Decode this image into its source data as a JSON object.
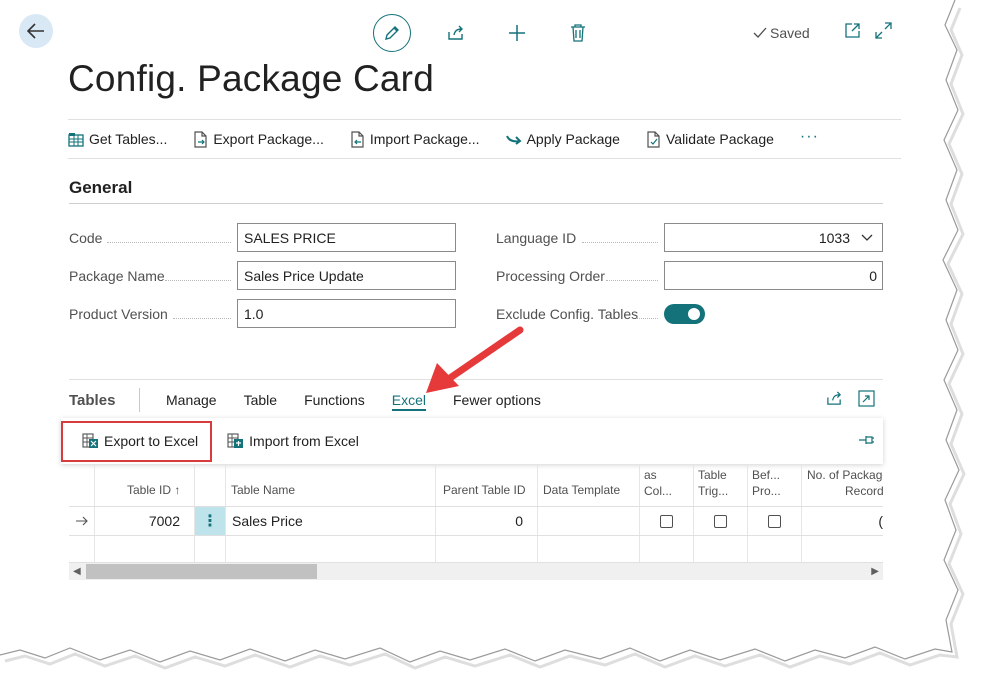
{
  "header": {
    "title": "Config. Package Card",
    "saved_label": "Saved",
    "icons": [
      "back-arrow-icon",
      "edit-pencil-icon",
      "share-icon",
      "plus-icon",
      "trash-icon",
      "checkmark-icon",
      "open-new-window-icon",
      "expand-icon"
    ]
  },
  "actions": [
    {
      "label": "Get Tables...",
      "icon": "get-tables-icon"
    },
    {
      "label": "Export Package...",
      "icon": "export-doc-icon"
    },
    {
      "label": "Import Package...",
      "icon": "import-doc-icon"
    },
    {
      "label": "Apply Package",
      "icon": "apply-arrow-icon"
    },
    {
      "label": "Validate Package",
      "icon": "validate-doc-icon"
    }
  ],
  "general": {
    "title": "General",
    "code": {
      "label": "Code",
      "value": "SALES PRICE"
    },
    "package_name": {
      "label": "Package Name",
      "value": "Sales Price Update"
    },
    "product_version": {
      "label": "Product Version",
      "value": "1.0"
    },
    "language_id": {
      "label": "Language ID",
      "value": "1033"
    },
    "processing_order": {
      "label": "Processing Order",
      "value": "0"
    },
    "exclude_config": {
      "label": "Exclude Config. Tables",
      "on": true
    }
  },
  "tables": {
    "title": "Tables",
    "tabs": [
      "Manage",
      "Table",
      "Functions",
      "Excel",
      "Fewer options"
    ],
    "active_tab": "Excel",
    "excel_actions": {
      "export": "Export to Excel",
      "import": "Import from Excel"
    },
    "columns": {
      "table_id": "Table ID ↑",
      "table_name": "Table Name",
      "parent_table_id": "Parent Table ID",
      "data_template": "Data Template",
      "c1_line1": "as",
      "c1_line2": "Col...",
      "c2_line1": "Table",
      "c2_line2": "Trig...",
      "c3_line1": "Bef...",
      "c3_line2": "Pro...",
      "c4_line1": "No. of Package",
      "c4_line2": "Record"
    },
    "rows": [
      {
        "table_id": "7002",
        "table_name": "Sales Price",
        "parent_table_id": "0",
        "data_template": "",
        "c1": false,
        "c2": false,
        "c3": false,
        "records": "("
      }
    ]
  },
  "colors": {
    "accent": "#13727a",
    "highlight": "#d83b3b",
    "back_button_bg": "#d9e8f5",
    "selected_cell": "#bfe3ea"
  }
}
